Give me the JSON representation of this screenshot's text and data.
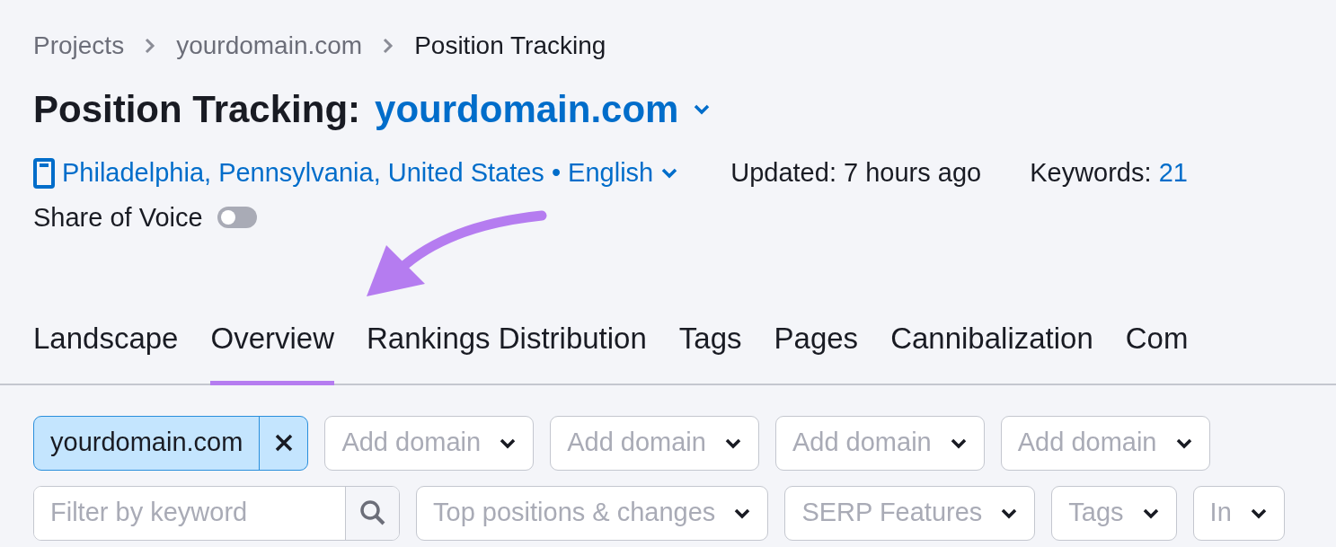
{
  "breadcrumbs": [
    "Projects",
    "yourdomain.com",
    "Position Tracking"
  ],
  "title": {
    "prefix": "Position Tracking:",
    "domain": "yourdomain.com"
  },
  "location": "Philadelphia, Pennsylvania, United States • English",
  "updated": "Updated: 7 hours ago",
  "keywords": {
    "label": "Keywords:",
    "value": "21"
  },
  "share_of_voice": {
    "label": "Share of Voice",
    "on": false
  },
  "tabs": [
    {
      "label": "Landscape",
      "selected": false
    },
    {
      "label": "Overview",
      "selected": true
    },
    {
      "label": "Rankings Distribution",
      "selected": false
    },
    {
      "label": "Tags",
      "selected": false
    },
    {
      "label": "Pages",
      "selected": false
    },
    {
      "label": "Cannibalization",
      "selected": false
    },
    {
      "label": "Com",
      "selected": false
    }
  ],
  "domains": [
    {
      "kind": "chip",
      "value": "yourdomain.com"
    },
    {
      "kind": "add",
      "placeholder": "Add domain"
    },
    {
      "kind": "add",
      "placeholder": "Add domain"
    },
    {
      "kind": "add",
      "placeholder": "Add domain"
    },
    {
      "kind": "add",
      "placeholder": "Add domain"
    }
  ],
  "filters": [
    {
      "kind": "search",
      "placeholder": "Filter by keyword"
    },
    {
      "kind": "dropdown",
      "label": "Top positions & changes"
    },
    {
      "kind": "dropdown",
      "label": "SERP Features"
    },
    {
      "kind": "dropdown",
      "label": "Tags"
    },
    {
      "kind": "dropdown",
      "label": "In"
    }
  ]
}
